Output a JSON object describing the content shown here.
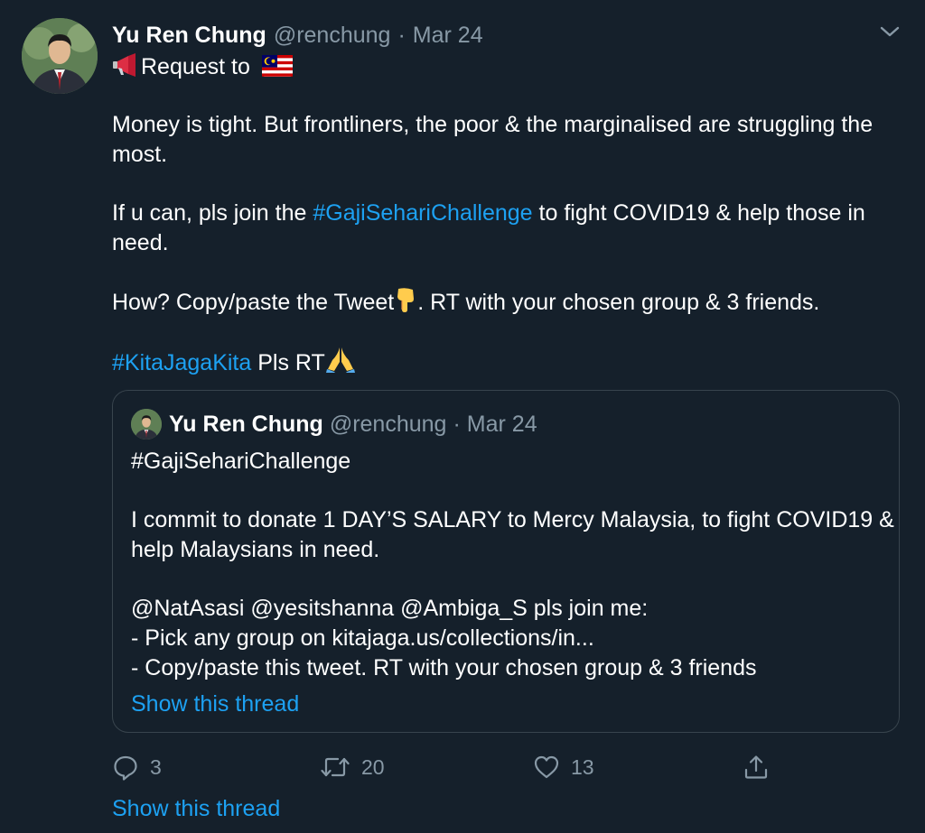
{
  "tweet": {
    "author_name": "Yu Ren Chung",
    "author_handle": "@renchung",
    "separator": "·",
    "date": "Mar 24",
    "line1_text": "Request to",
    "para1_l1": "Money is tight. But frontliners, the poor & the marginalised are struggling the",
    "para1_l2": "most.",
    "para2_pre": "If u can, pls join the ",
    "para2_hashtag": "#GajiSehariChallenge",
    "para2_post": " to fight COVID19 & help those in",
    "para2_l2": "need.",
    "para3_pre": "How? Copy/paste the Tweet",
    "para3_post": ". RT with your chosen group & 3 friends.",
    "para4_hashtag": "#KitaJagaKita",
    "para4_post": " Pls RT"
  },
  "quoted": {
    "author_name": "Yu Ren Chung",
    "author_handle": "@renchung",
    "separator": "·",
    "date": "Mar 24",
    "line1": "#GajiSehariChallenge",
    "line2": "I commit to donate 1 DAY’S SALARY to Mercy Malaysia, to fight COVID19 &",
    "line3": "help Malaysians in need.",
    "line4": "@NatAsasi @yesitshanna @Ambiga_S pls join me:",
    "line5": "- Pick any group on kitajaga.us/collections/in...",
    "line6": "- Copy/paste this tweet. RT with your chosen group & 3 friends",
    "show_thread": "Show this thread"
  },
  "actions": {
    "reply_count": "3",
    "retweet_count": "20",
    "like_count": "13"
  },
  "show_thread": "Show this thread",
  "icons": [
    "megaphone-icon",
    "malaysia-flag-icon",
    "chevron-down-icon",
    "point-down-icon",
    "pray-icon",
    "reply-icon",
    "retweet-icon",
    "like-icon",
    "share-icon"
  ],
  "colors": {
    "background": "#15202b",
    "link": "#1da1f2",
    "secondary": "#8899a6",
    "border": "#38444d"
  }
}
